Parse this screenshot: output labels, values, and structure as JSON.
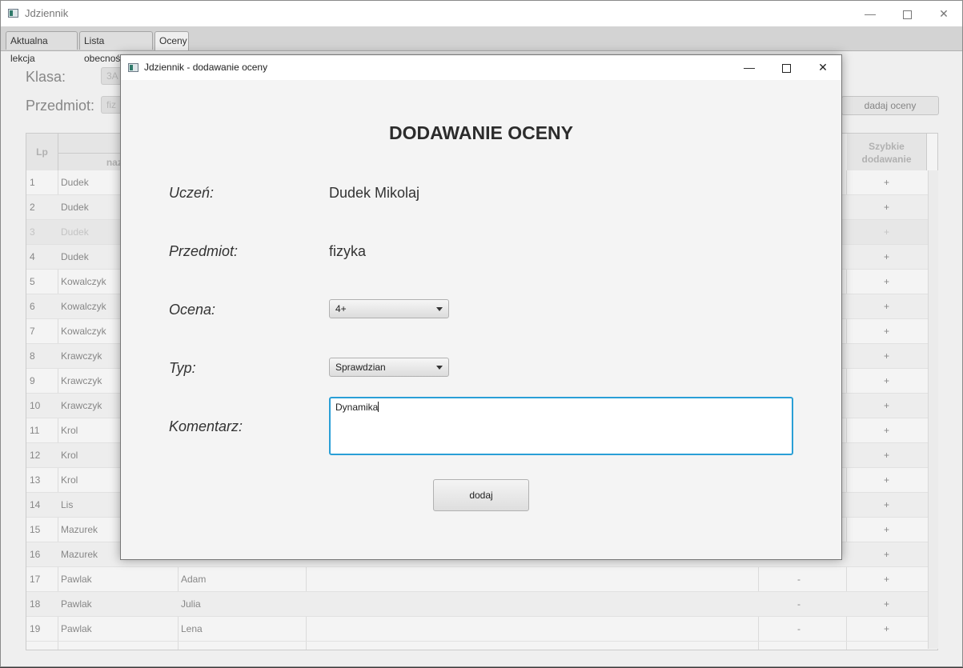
{
  "main_window": {
    "title": "Jdziennik",
    "controls": {
      "minimize": "—",
      "close": "✕"
    }
  },
  "tabs": [
    {
      "label": "Aktualna lekcja"
    },
    {
      "label": "Lista obecności"
    },
    {
      "label": "Oceny",
      "active": true
    }
  ],
  "grades_form": {
    "class_label": "Klasa:",
    "class_value": "3A",
    "subject_label": "Przedmiot:",
    "subject_value": "fiz",
    "add_grades_button": "dadaj oceny"
  },
  "table": {
    "headers": {
      "lp": "Lp",
      "name_partial": "nazw",
      "quick_add": "Szybkie dodawanie"
    },
    "rows": [
      {
        "lp": "1",
        "surname": "Dudek",
        "firstname": "",
        "dash": "",
        "plus": "+"
      },
      {
        "lp": "2",
        "surname": "Dudek",
        "firstname": "",
        "dash": "",
        "plus": "+"
      },
      {
        "lp": "3",
        "surname": "Dudek",
        "firstname": "",
        "dash": "",
        "plus": "+"
      },
      {
        "lp": "4",
        "surname": "Dudek",
        "firstname": "",
        "dash": "",
        "plus": "+"
      },
      {
        "lp": "5",
        "surname": "Kowalczyk",
        "firstname": "",
        "dash": "",
        "plus": "+"
      },
      {
        "lp": "6",
        "surname": "Kowalczyk",
        "firstname": "",
        "dash": "",
        "plus": "+"
      },
      {
        "lp": "7",
        "surname": "Kowalczyk",
        "firstname": "",
        "dash": "",
        "plus": "+"
      },
      {
        "lp": "8",
        "surname": "Krawczyk",
        "firstname": "",
        "dash": "",
        "plus": "+"
      },
      {
        "lp": "9",
        "surname": "Krawczyk",
        "firstname": "",
        "dash": "",
        "plus": "+"
      },
      {
        "lp": "10",
        "surname": "Krawczyk",
        "firstname": "",
        "dash": "",
        "plus": "+"
      },
      {
        "lp": "11",
        "surname": "Krol",
        "firstname": "",
        "dash": "",
        "plus": "+"
      },
      {
        "lp": "12",
        "surname": "Krol",
        "firstname": "",
        "dash": "",
        "plus": "+"
      },
      {
        "lp": "13",
        "surname": "Krol",
        "firstname": "",
        "dash": "",
        "plus": "+"
      },
      {
        "lp": "14",
        "surname": "Lis",
        "firstname": "",
        "dash": "",
        "plus": "+"
      },
      {
        "lp": "15",
        "surname": "Mazurek",
        "firstname": "",
        "dash": "",
        "plus": "+"
      },
      {
        "lp": "16",
        "surname": "Mazurek",
        "firstname": "",
        "dash": "",
        "plus": "+"
      },
      {
        "lp": "17",
        "surname": "Pawlak",
        "firstname": "Adam",
        "dash": "-",
        "plus": "+"
      },
      {
        "lp": "18",
        "surname": "Pawlak",
        "firstname": "Julia",
        "dash": "-",
        "plus": "+"
      },
      {
        "lp": "19",
        "surname": "Pawlak",
        "firstname": "Lena",
        "dash": "-",
        "plus": "+"
      }
    ]
  },
  "dialog": {
    "title": "Jdziennik - dodawanie oceny",
    "controls": {
      "minimize": "—",
      "close": "✕"
    },
    "heading": "DODAWANIE OCENY",
    "student_label": "Uczeń:",
    "student_value": "Dudek  Mikolaj",
    "subject_label": "Przedmiot:",
    "subject_value": "fizyka",
    "grade_label": "Ocena:",
    "grade_value": "4+",
    "type_label": "Typ:",
    "type_value": "Sprawdzian",
    "comment_label": "Komentarz:",
    "comment_value": "Dynamika",
    "submit_label": "dodaj"
  },
  "colors": {
    "focus_border": "#2a9fd6",
    "window_background": "#f4f4f4"
  }
}
